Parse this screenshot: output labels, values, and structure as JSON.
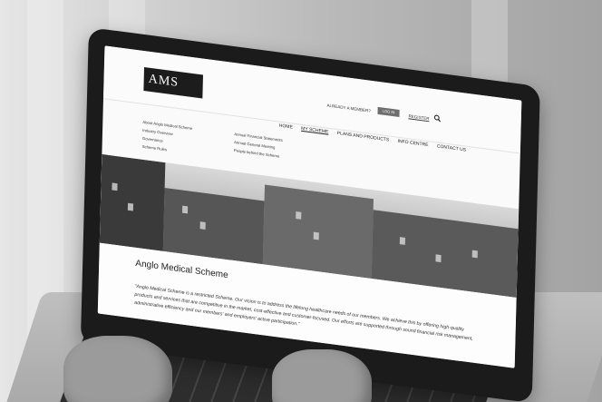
{
  "header": {
    "logo_text": "AMS",
    "member_prompt": "ALREADY A MEMBER?",
    "login_label": "LOG IN",
    "register_label": "REGISTER"
  },
  "nav": {
    "items": [
      "HOME",
      "MY SCHEME",
      "PLANS AND PRODUCTS",
      "INFO CENTRE",
      "CONTACT US"
    ]
  },
  "submenu": {
    "left": [
      "About Anglo Medical Scheme",
      "Industry Overview",
      "Governance",
      "Scheme Rules"
    ],
    "right": [
      "Annual Financial Statements",
      "Annual General Meeting",
      "People behind the Scheme"
    ]
  },
  "content": {
    "title": "Anglo Medical Scheme",
    "quote": "\"Anglo Medical Scheme is a restricted Scheme. Our vision is to address the lifelong healthcare needs of our members. We achieve this by offering high-quality products and services that are competitive in the market, cost-effective and customer-focused. Our efforts are supported through sound financial risk management, administrative efficiency and our members' and employers' active participation.\""
  }
}
